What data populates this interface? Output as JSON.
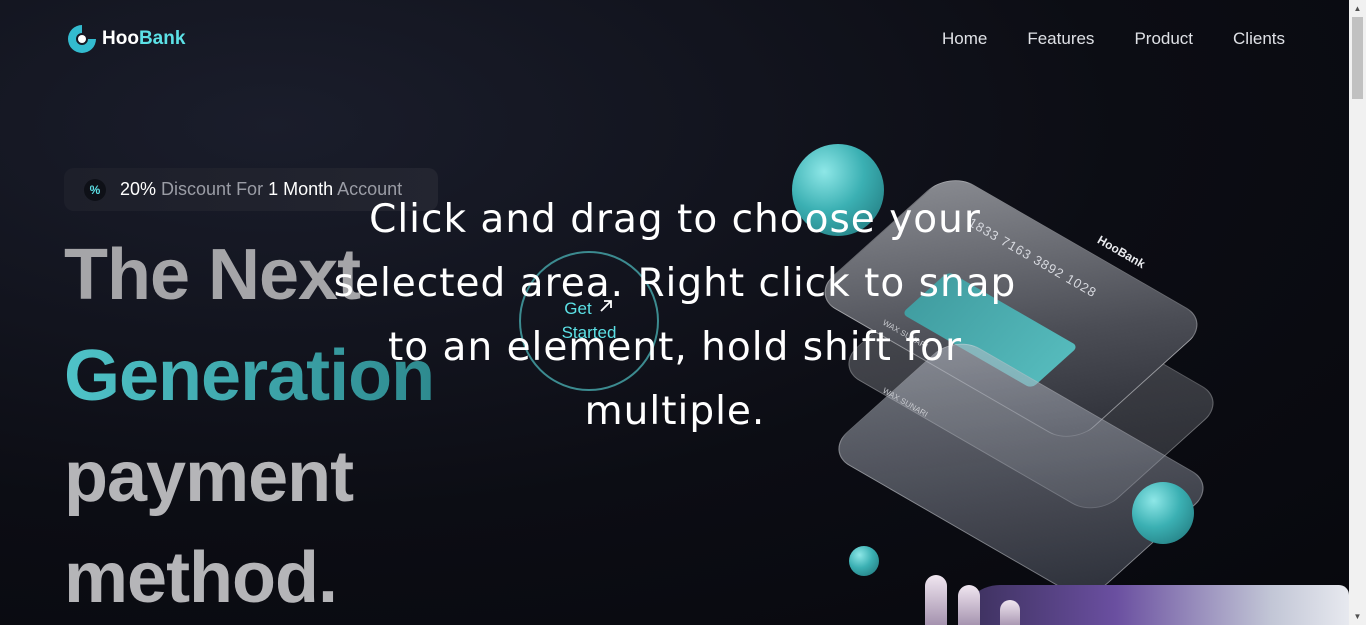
{
  "brand": {
    "part1": "Hoo",
    "part2": "Bank"
  },
  "nav": {
    "items": [
      "Home",
      "Features",
      "Product",
      "Clients"
    ]
  },
  "badge": {
    "icon": "percent-icon",
    "text_1": "20%",
    "text_2": " Discount For ",
    "text_3": "1 Month",
    "text_4": " Account"
  },
  "headline": {
    "line1": "The Next",
    "line2": "Generation",
    "line3": "payment",
    "line4": "method."
  },
  "cta": {
    "line1": "Get",
    "line2": "Started",
    "icon": "arrow-up-right-icon"
  },
  "card": {
    "number": "1833 7163 3892 1028",
    "brand": "HooBank",
    "holder": "WAX SUNARI"
  },
  "overlay": {
    "text": "Click and drag to choose your selected area. Right click to snap to an element, hold shift for multiple."
  },
  "colors": {
    "accent": "#5ce1e6",
    "background": "#0c0d14",
    "sphere": "#3bb0b3"
  }
}
